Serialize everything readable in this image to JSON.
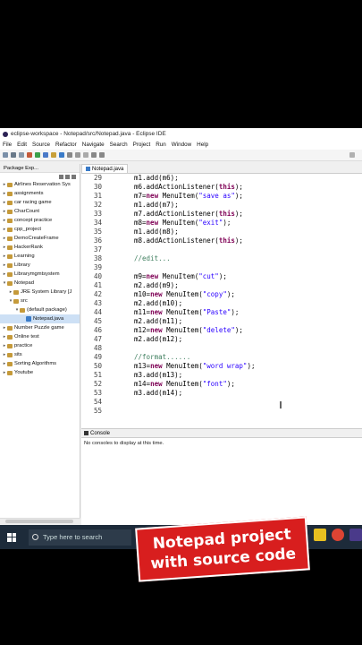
{
  "window": {
    "title": "eclipse-workspace - Notepad/src/Notepad.java - Eclipse IDE"
  },
  "menu": [
    "File",
    "Edit",
    "Source",
    "Refactor",
    "Navigate",
    "Search",
    "Project",
    "Run",
    "Window",
    "Help"
  ],
  "package_explorer": {
    "tab_label": "Package Exp...",
    "items": [
      {
        "label": "Airlines Reservation Sys",
        "indent": 0
      },
      {
        "label": "assignments",
        "indent": 0
      },
      {
        "label": "car racing game",
        "indent": 0
      },
      {
        "label": "CharCount",
        "indent": 0
      },
      {
        "label": "concept practice",
        "indent": 0
      },
      {
        "label": "cpp_project",
        "indent": 0
      },
      {
        "label": "DemoCreateFrame",
        "indent": 0
      },
      {
        "label": "HackerRank",
        "indent": 0
      },
      {
        "label": "Learning",
        "indent": 0
      },
      {
        "label": "Library",
        "indent": 0
      },
      {
        "label": "Librarymgmtsystem",
        "indent": 0
      },
      {
        "label": "Notepad",
        "indent": 0
      },
      {
        "label": "JRE System Library [J",
        "indent": 1
      },
      {
        "label": "src",
        "indent": 1
      },
      {
        "label": "(default package)",
        "indent": 2
      },
      {
        "label": "Notepad.java",
        "indent": 3
      },
      {
        "label": "Number Puzzle game",
        "indent": 0
      },
      {
        "label": "Online test",
        "indent": 0
      },
      {
        "label": "practice",
        "indent": 0
      },
      {
        "label": "sits",
        "indent": 0
      },
      {
        "label": "Sorting Algorithms",
        "indent": 0
      },
      {
        "label": "Youtube",
        "indent": 0
      }
    ]
  },
  "editor": {
    "tab_label": "Notepad.java",
    "lines": [
      {
        "n": "29",
        "text": "m1.add(m6);"
      },
      {
        "n": "30",
        "text": "m6.addActionListener(this);"
      },
      {
        "n": "31",
        "text": "m7=new MenuItem(\"save as\");"
      },
      {
        "n": "32",
        "text": "m1.add(m7);"
      },
      {
        "n": "33",
        "text": "m7.addActionListener(this);"
      },
      {
        "n": "34",
        "text": "m8=new MenuItem(\"exit\");"
      },
      {
        "n": "35",
        "text": "m1.add(m8);"
      },
      {
        "n": "36",
        "text": "m8.addActionListener(this);"
      },
      {
        "n": "37",
        "text": ""
      },
      {
        "n": "38",
        "text": "//edit..."
      },
      {
        "n": "39",
        "text": ""
      },
      {
        "n": "40",
        "text": "m9=new MenuItem(\"cut\");"
      },
      {
        "n": "41",
        "text": "m2.add(m9);"
      },
      {
        "n": "42",
        "text": "m10=new MenuItem(\"copy\");"
      },
      {
        "n": "43",
        "text": "m2.add(m10);"
      },
      {
        "n": "44",
        "text": "m11=new MenuItem(\"Paste\");"
      },
      {
        "n": "45",
        "text": "m2.add(m11);"
      },
      {
        "n": "46",
        "text": "m12=new MenuItem(\"delete\");"
      },
      {
        "n": "47",
        "text": "m2.add(m12);"
      },
      {
        "n": "48",
        "text": ""
      },
      {
        "n": "49",
        "text": "//format......"
      },
      {
        "n": "50",
        "text": "m13=new MenuItem(\"word wrap\");"
      },
      {
        "n": "51",
        "text": "m3.add(m13);"
      },
      {
        "n": "52",
        "text": "m14=new MenuItem(\"font\");"
      },
      {
        "n": "53",
        "text": "m3.add(m14);"
      },
      {
        "n": "54",
        "text": ""
      },
      {
        "n": "55",
        "text": ""
      }
    ]
  },
  "console": {
    "tab_label": "Console",
    "message": "No consoles to display at this time."
  },
  "taskbar": {
    "search_placeholder": "Type here to search"
  },
  "overlay": {
    "line1": "Notepad project",
    "line2": "with source code"
  },
  "colors": {
    "keyword": "#7f0055",
    "string": "#2a00ff",
    "comment": "#3f7f5f",
    "overlay_bg": "#d81e1e",
    "taskbar_bg": "#1d2b3a"
  }
}
